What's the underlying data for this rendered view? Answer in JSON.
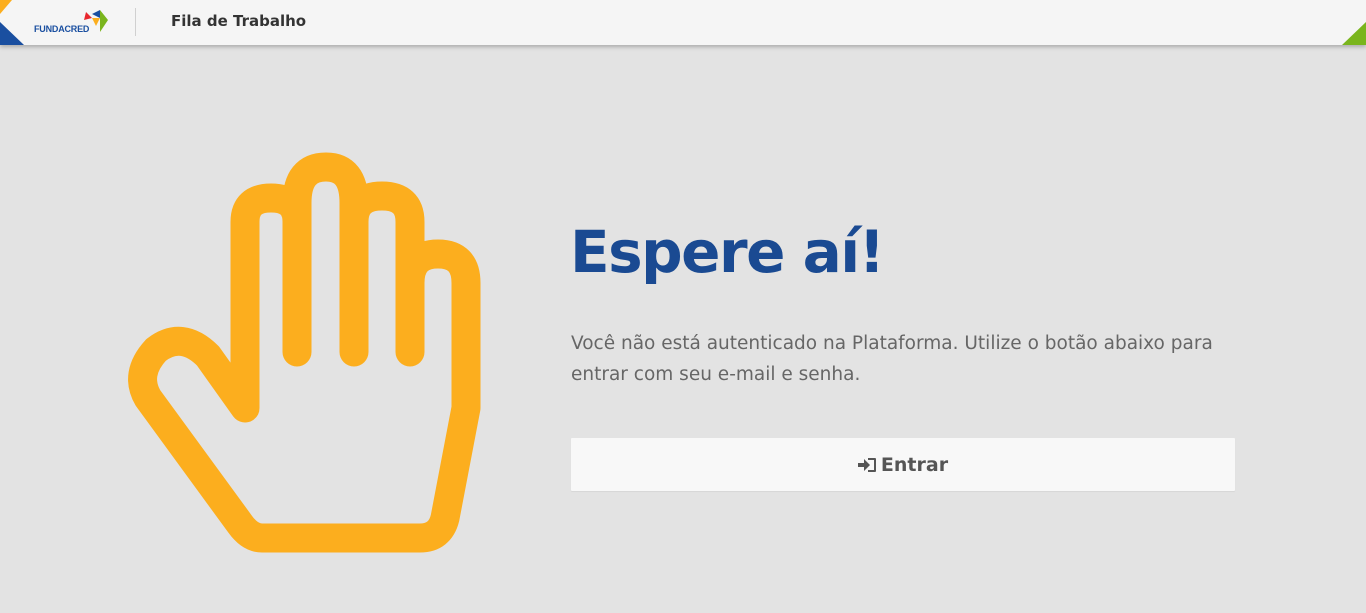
{
  "header": {
    "logo_text": "FUNDACRED",
    "title": "Fila de Trabalho"
  },
  "main": {
    "illustration": "raised-hand-icon",
    "heading": "Espere aí!",
    "message": "Você não está autenticado na Plataforma. Utilize o botão abaixo para entrar com seu e-mail e senha.",
    "login_button": {
      "icon": "sign-in-icon",
      "label": "Entrar"
    }
  },
  "colors": {
    "header_bg": "#f5f5f5",
    "page_bg": "#e3e3e3",
    "heading": "#1a4a92",
    "hand": "#fcae1e",
    "corner_left_blue": "#1a4fa0",
    "corner_left_yellow": "#fcae1e",
    "corner_right_green": "#7ab51d"
  }
}
